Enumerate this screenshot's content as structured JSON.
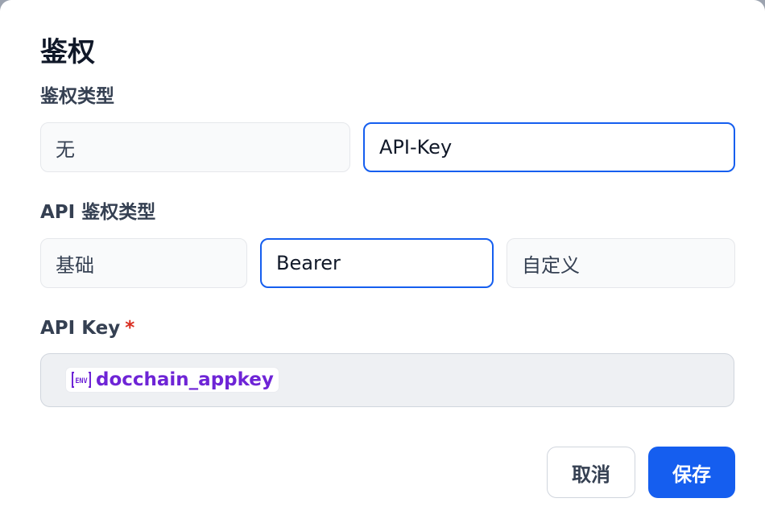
{
  "dialog": {
    "title": "鉴权",
    "auth_type": {
      "label": "鉴权类型",
      "options": [
        "无",
        "API-Key"
      ],
      "selected": "API-Key"
    },
    "api_auth_type": {
      "label": "API 鉴权类型",
      "options": [
        "基础",
        "Bearer",
        "自定义"
      ],
      "selected": "Bearer"
    },
    "api_key": {
      "label": "API Key",
      "required_mark": "*",
      "env_badge": "ENV",
      "value": "docchain_appkey"
    },
    "buttons": {
      "cancel": "取消",
      "save": "保存"
    },
    "colors": {
      "accent": "#155eef",
      "env_text": "#6e24d6",
      "required": "#d92d20"
    }
  }
}
